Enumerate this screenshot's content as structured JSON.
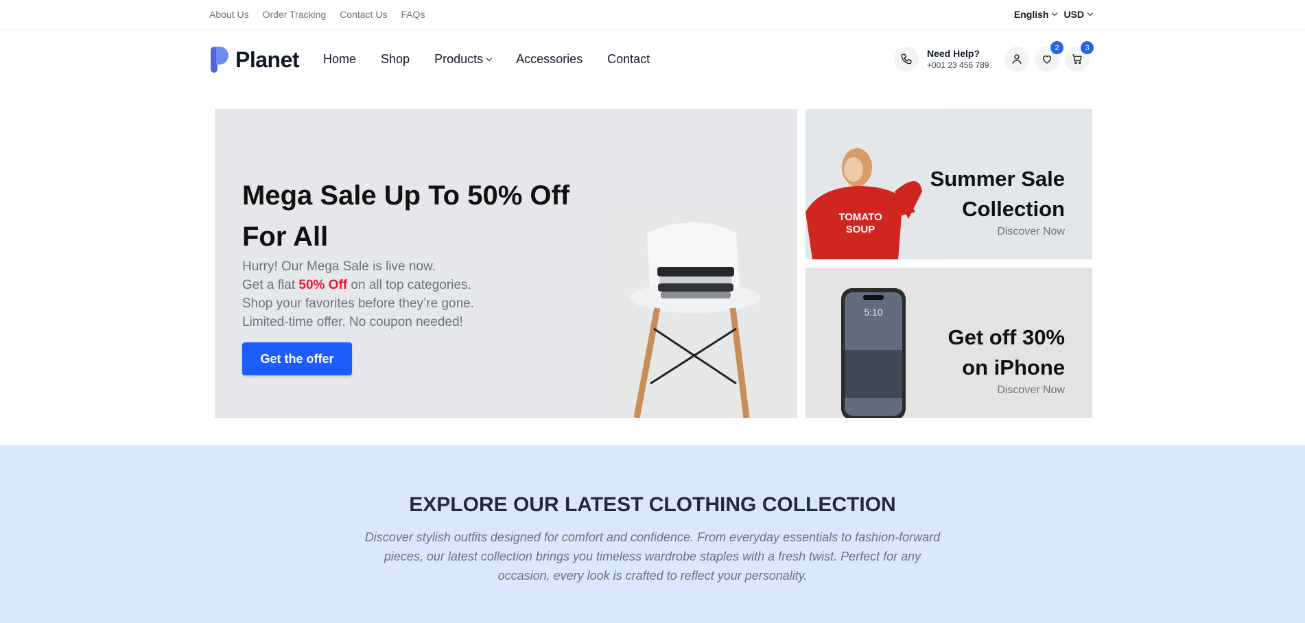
{
  "topbar": {
    "links": [
      "About Us",
      "Order Tracking",
      "Contact Us",
      "FAQs"
    ],
    "language": "English",
    "currency": "USD"
  },
  "header": {
    "logo_text": "Planet",
    "nav": [
      "Home",
      "Shop",
      "Products",
      "Accessories",
      "Contact"
    ],
    "help_title": "Need Help?",
    "help_phone": "+001 23 456 789",
    "wishlist_count": "2",
    "cart_count": "3"
  },
  "hero": {
    "title": "Mega Sale Up To 50% Off For All",
    "line1": "Hurry! Our Mega Sale is live now.",
    "line2_prefix": "Get a flat ",
    "line2_highlight": "50% Off",
    "line2_suffix": " on all top categories.",
    "line3": "Shop your favorites before they’re gone.",
    "line4": "Limited-time offer. No coupon needed!",
    "button": "Get the offer"
  },
  "cards": [
    {
      "title_line1": "Summer Sale",
      "title_line2": "Collection",
      "link": "Discover Now",
      "image_text1": "TOMATO",
      "image_text2": "SOUP"
    },
    {
      "title_line1": "Get off 30%",
      "title_line2": "on iPhone",
      "link": "Discover Now",
      "image_text1": "5:10"
    }
  ],
  "explore": {
    "title": "EXPLORE OUR LATEST CLOTHING COLLECTION",
    "description": "Discover stylish outfits designed for comfort and confidence. From everyday essentials to fashion-forward pieces, our latest collection brings you timeless wardrobe staples with a fresh twist. Perfect for any occasion, every look is crafted to reflect your personality."
  },
  "colors": {
    "accent": "#1d5cff",
    "highlight": "#e11d2e",
    "explore_bg": "#dae8fc"
  }
}
